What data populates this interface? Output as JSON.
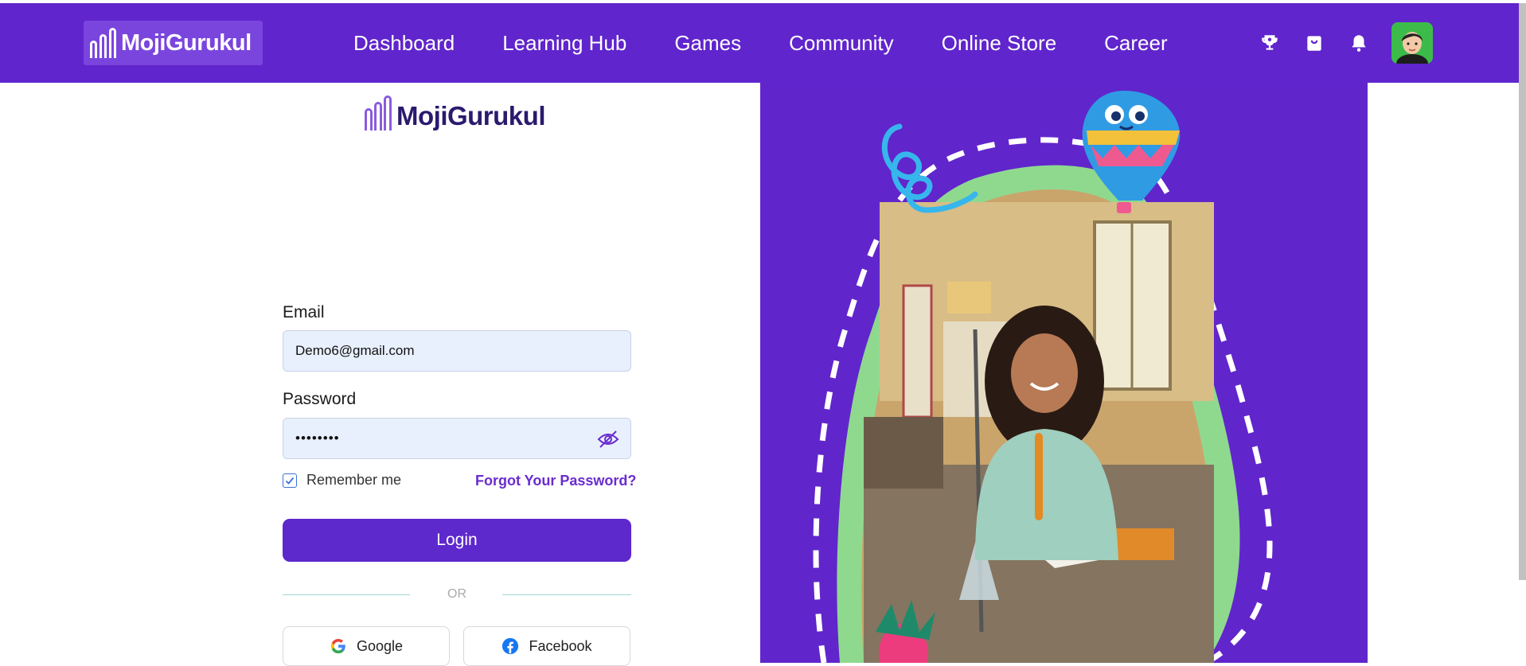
{
  "brand": {
    "name": "MojiGurukul"
  },
  "nav": {
    "links": [
      "Dashboard",
      "Learning Hub",
      "Games",
      "Community",
      "Online Store",
      "Career"
    ],
    "icons": [
      "trophy-icon",
      "shopping-bag-icon",
      "bell-icon"
    ],
    "avatar": "user-avatar"
  },
  "login": {
    "logo_text": "MojiGurukul",
    "email_label": "Email",
    "email_value": "Demo6@gmail.com",
    "password_label": "Password",
    "password_value": "••••••••",
    "remember_label": "Remember me",
    "remember_checked": true,
    "forgot_label": "Forgot Your Password?",
    "login_button": "Login",
    "or_text": "OR",
    "google_label": "Google",
    "facebook_label": "Facebook"
  },
  "colors": {
    "primary": "#6025cc",
    "accent_green": "#8fd98f",
    "field_bg": "#e8f0fd",
    "link": "#6a2ccf"
  }
}
